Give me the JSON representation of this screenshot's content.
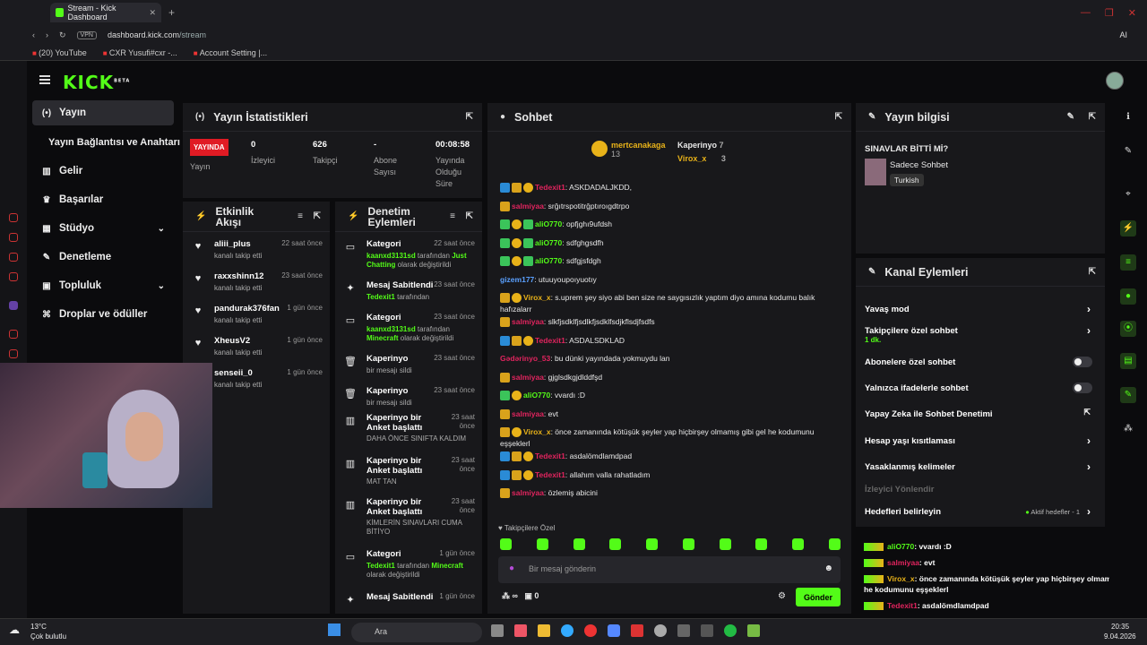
{
  "browser": {
    "tab_title": "Stream - Kick Dashboard",
    "url_host": "dashboard.kick.com",
    "url_path": "/stream",
    "vpn": "VPN",
    "bookmarks": [
      "(20) YouTube",
      "CXR Yusufi#cxr -...",
      "Account Setting |..."
    ],
    "ai": "AI"
  },
  "brand": {
    "logo": "KICK",
    "beta": "BETA",
    "accent": "#53fc18"
  },
  "nav": {
    "items": [
      {
        "label": "Yayın",
        "icon": "broadcast-icon"
      },
      {
        "label": "Yayın Bağlantısı ve Anahtarı",
        "icon": ""
      },
      {
        "label": "Gelir",
        "icon": "chart-icon"
      },
      {
        "label": "Başarılar",
        "icon": "trophy-icon"
      },
      {
        "label": "Stüdyo",
        "icon": "studio-icon"
      },
      {
        "label": "Denetleme",
        "icon": "wrench-icon"
      },
      {
        "label": "Topluluk",
        "icon": "community-icon"
      },
      {
        "label": "Droplar ve ödüller",
        "icon": "gift-icon"
      }
    ]
  },
  "stats": {
    "title": "Yayın İstatistikleri",
    "live_badge": "YAYINDA",
    "live_label": "Yayın",
    "viewers": "0",
    "viewers_label": "İzleyici",
    "followers": "626",
    "followers_label": "Takipçi",
    "subs": "-",
    "subs_label": "Abone Sayısı",
    "uptime": "00:08:58",
    "uptime_label": "Yayında Olduğu Süre"
  },
  "activity": {
    "title": "Etkinlik Akışı",
    "items": [
      {
        "user": "aliii_plus",
        "text": "kanalı takip etti",
        "time": "22 saat önce"
      },
      {
        "user": "raxxshinn12",
        "text": "kanalı takip etti",
        "time": "23 saat önce"
      },
      {
        "user": "pandurak376fan",
        "text": "kanalı takip etti",
        "time": "1 gün önce"
      },
      {
        "user": "XheusV2",
        "text": "kanalı takip etti",
        "time": "1 gün önce"
      },
      {
        "user": "senseii_0",
        "text": "kanalı takip etti",
        "time": "1 gün önce"
      }
    ]
  },
  "moderation": {
    "title": "Denetim Eylemleri",
    "items": [
      {
        "title": "Kategori",
        "time": "22 saat önce",
        "actor": "kaanxd3131sd",
        "mid": " tarafından ",
        "target": "Just Chatting",
        "tail": " olarak değiştirildi"
      },
      {
        "title": "Mesaj Sabitlendi",
        "time": "23 saat önce",
        "actor": "Tedexit1",
        "mid": " tarafından",
        "target": "",
        "tail": ""
      },
      {
        "title": "Kategori",
        "time": "23 saat önce",
        "actor": "kaanxd3131sd",
        "mid": " tarafından ",
        "target": "Minecraft",
        "tail": " olarak değiştirildi"
      },
      {
        "title": "Kaperinyo",
        "time": "23 saat önce",
        "actor": "",
        "mid": "bir mesajı sildi",
        "target": "",
        "tail": ""
      },
      {
        "title": "Kaperinyo",
        "time": "23 saat önce",
        "actor": "",
        "mid": "bir mesajı sildi",
        "target": "",
        "tail": ""
      },
      {
        "title": "Kaperinyo bir Anket başlattı",
        "time": "23 saat önce",
        "actor": "",
        "mid": "DAHA ÖNCE SINIFTA KALDIM",
        "target": "",
        "tail": ""
      },
      {
        "title": "Kaperinyo bir Anket başlattı",
        "time": "23 saat önce",
        "actor": "",
        "mid": "MAT TAN",
        "target": "",
        "tail": ""
      },
      {
        "title": "Kaperinyo bir Anket başlattı",
        "time": "23 saat önce",
        "actor": "",
        "mid": "KİMLERİN SINAVLARI CUMA BİTİYO",
        "target": "",
        "tail": ""
      },
      {
        "title": "Kategori",
        "time": "1 gün önce",
        "actor": "Tedexit1",
        "mid": " tarafından ",
        "target": "Minecraft",
        "tail": " olarak değiştirildi"
      },
      {
        "title": "Mesaj Sabitlendi",
        "time": "1 gün önce",
        "actor": "",
        "mid": "",
        "target": "",
        "tail": ""
      }
    ]
  },
  "chat": {
    "title": "Sohbet",
    "top": [
      {
        "name": "mertcanakaga",
        "count": "13"
      },
      {
        "name": "Kaperinyo",
        "count": "7"
      },
      {
        "name": "Virox_x",
        "count": "3"
      }
    ],
    "messages": [
      {
        "user": "Tedexit1",
        "color": "#e0245e",
        "text": "ASKDADALJKDD,",
        "b": [
          1,
          2,
          3
        ]
      },
      {
        "user": "salmiyaa",
        "color": "#e0245e",
        "text": "srğıtrspotitrğptıroıgdtrpo",
        "b": [
          2
        ]
      },
      {
        "user": "aliO770",
        "color": "#53fc18",
        "text": "opfjghı9ufdsh",
        "b": [
          4,
          3,
          4
        ]
      },
      {
        "user": "aliO770",
        "color": "#53fc18",
        "text": "sdfghgsdfh",
        "b": [
          4,
          3,
          4
        ]
      },
      {
        "user": "aliO770",
        "color": "#53fc18",
        "text": "sdfgjsfdgh",
        "b": [
          4,
          3,
          4
        ]
      },
      {
        "user": "gizem177",
        "color": "#5aa0ff",
        "text": "utuuyoupoıyuotıy",
        "b": []
      },
      {
        "user": "Virox_x",
        "color": "#e8b219",
        "text": "s.uprem şey siyo abi ben size ne saygısızlık yaptım diyo amına kodumu balık hafızalarr",
        "b": [
          2,
          3
        ]
      },
      {
        "user": "salmiyaa",
        "color": "#e0245e",
        "text": "slkfjsdklfjsdlkfjsdklfsdjkflsdjfsdfs",
        "b": [
          2
        ]
      },
      {
        "user": "Tedexit1",
        "color": "#e0245e",
        "text": "ASDALSDKLAD",
        "b": [
          1,
          2,
          3
        ]
      },
      {
        "user": "Gədərinyo_53",
        "color": "#e0245e",
        "text": "bu dünki yayındada yokmuydu lan",
        "b": []
      },
      {
        "user": "salmiyaa",
        "color": "#e0245e",
        "text": "gjglsdkgjdlddfşd",
        "b": [
          2
        ]
      },
      {
        "user": "aliO770",
        "color": "#53fc18",
        "text": "vvardı :D",
        "b": [
          4,
          3
        ]
      },
      {
        "user": "salmiyaa",
        "color": "#e0245e",
        "text": "evt",
        "b": [
          2
        ]
      },
      {
        "user": "Virox_x",
        "color": "#e8b219",
        "text": "önce zamanında kötüşük şeyler yap hiçbirşey olmamış gibi gel he kodumunu eşşeklerl",
        "b": [
          2,
          3
        ]
      },
      {
        "user": "Tedexit1",
        "color": "#e0245e",
        "text": "asdalömdlamdpad",
        "b": [
          1,
          2,
          3
        ]
      },
      {
        "user": "Tedexit1",
        "color": "#e0245e",
        "text": "allahım valla rahatladım",
        "b": [
          1,
          2,
          3
        ]
      },
      {
        "user": "salmiyaa",
        "color": "#e0245e",
        "text": "özlemiş abicini",
        "b": [
          2
        ]
      }
    ],
    "mode": "Takipçilere Özel",
    "placeholder": "Bir mesaj gönderin",
    "points": "0",
    "send": "Gönder"
  },
  "info": {
    "title": "Yayın bilgisi",
    "stream_title": "SINAVLAR BİTTİ Mİ?",
    "category": "Sadece Sohbet",
    "language": "Turkish"
  },
  "actions": {
    "title": "Kanal Eylemleri",
    "items": [
      {
        "label": "Yavaş mod",
        "sub": "",
        "ctl": "chev"
      },
      {
        "label": "Takipçilere özel sohbet",
        "sub": "1 dk.",
        "ctl": "chev"
      },
      {
        "label": "Abonelere özel sohbet",
        "sub": "",
        "ctl": "toggle"
      },
      {
        "label": "Yalnızca ifadelerle sohbet",
        "sub": "",
        "ctl": "toggle"
      },
      {
        "label": "Yapay Zeka ile Sohbet Denetimi",
        "sub": "",
        "ctl": "ext"
      },
      {
        "label": "Hesap yaşı kısıtlaması",
        "sub": "",
        "ctl": "chev"
      },
      {
        "label": "Yasaklanmış kelimeler",
        "sub": "",
        "ctl": "chev"
      },
      {
        "label": "İzleyici Yönlendir",
        "sub": "",
        "ctl": "none"
      },
      {
        "label": "Hedefleri belirleyin",
        "sub": "",
        "ctl": "goal"
      }
    ],
    "goal_badge": "Aktif hedefler - 1"
  },
  "overlay": [
    {
      "user": "aliO770",
      "color": "#53fc18",
      "text": ": vvardı :D"
    },
    {
      "user": "salmiyaa",
      "color": "#e0245e",
      "text": ": evt"
    },
    {
      "user": "Virox_x",
      "color": "#e8b219",
      "text": ": önce zamanında kötüşük şeyler yap hiçbirşey olmamış gibi gel he kodumunu eşşeklerl"
    },
    {
      "user": "Tedexit1",
      "color": "#e0245e",
      "text": ": asdalömdlamdpad"
    },
    {
      "user": "Tedexit1",
      "color": "#e0245e",
      "text": ": allahım valla rahatladım"
    },
    {
      "user": "salmiyaa",
      "color": "#e0245e",
      "text": ": özlemiş abicini"
    }
  ],
  "taskbar": {
    "weather_temp": "13°C",
    "weather_desc": "Çok bulutlu",
    "search": "Ara",
    "time": "20:35",
    "date": "9.04.2026"
  }
}
